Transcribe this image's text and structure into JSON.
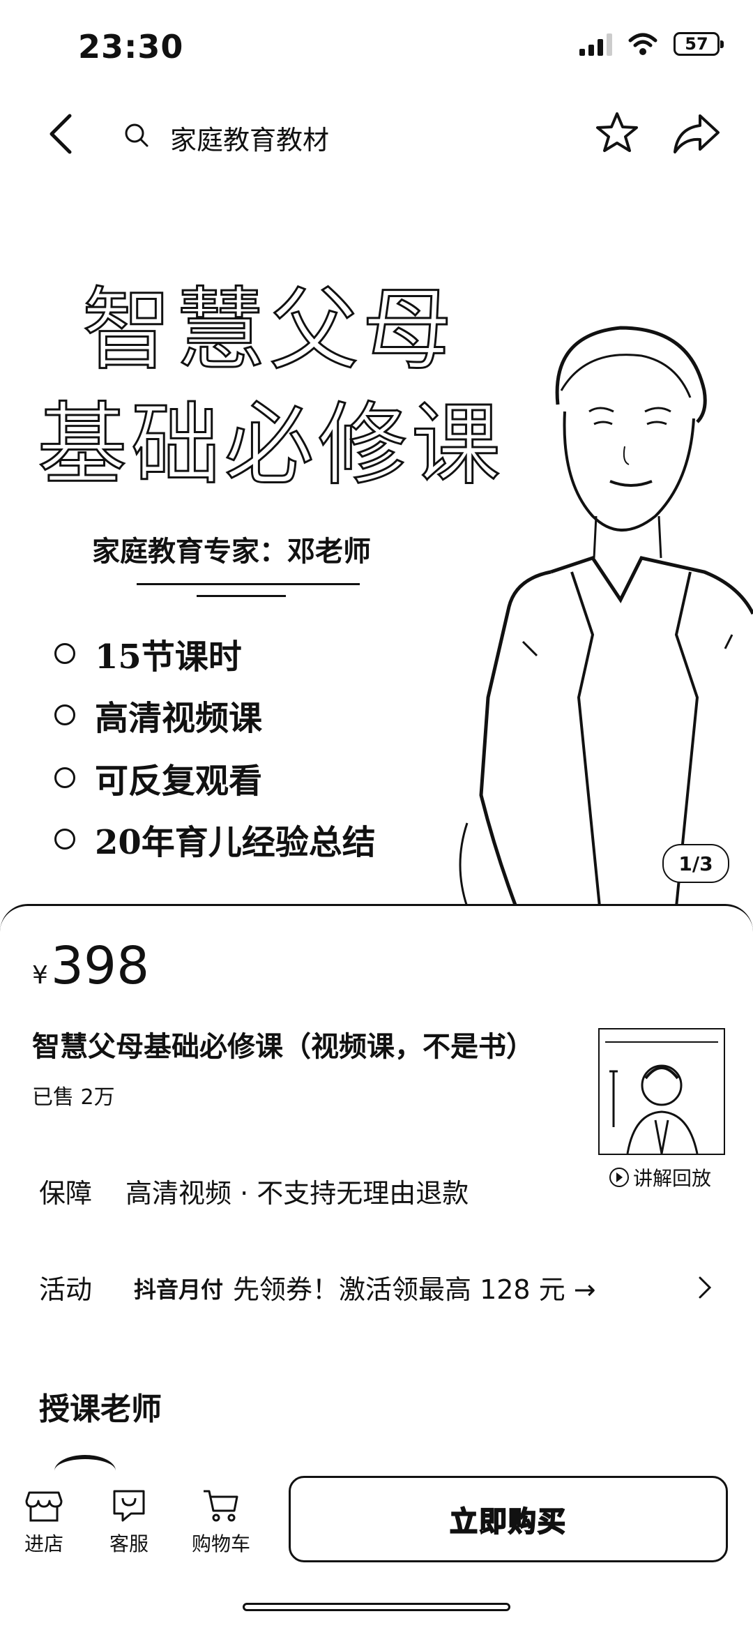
{
  "status": {
    "time": "23:30",
    "battery": "57"
  },
  "header": {
    "search_text": "家庭教育教材"
  },
  "hero": {
    "title_line1": "智慧父母",
    "title_line2": "基础必修课",
    "expert": "家庭教育专家：邓老师",
    "features": [
      "15节课时",
      "高清视频课",
      "可反复观看",
      "20年育儿经验总结"
    ],
    "pager": "1/3"
  },
  "product": {
    "currency": "¥",
    "price": "398",
    "title": "智慧父母基础必修课（视频课，不是书）",
    "sold": "已售 2万",
    "replay": "讲解回放"
  },
  "guarantee": {
    "label": "保障",
    "text": "高清视频 · 不支持无理由退款"
  },
  "activity": {
    "label": "活动",
    "brand": "抖音月付",
    "text": "先领券！激活领最高 128 元 →"
  },
  "teacher_section": {
    "title": "授课老师"
  },
  "bottom_bar": {
    "tabs": [
      {
        "label": "进店",
        "icon": "store-icon"
      },
      {
        "label": "客服",
        "icon": "chat-icon"
      },
      {
        "label": "购物车",
        "icon": "cart-icon"
      }
    ],
    "buy_label": "立即购买"
  }
}
